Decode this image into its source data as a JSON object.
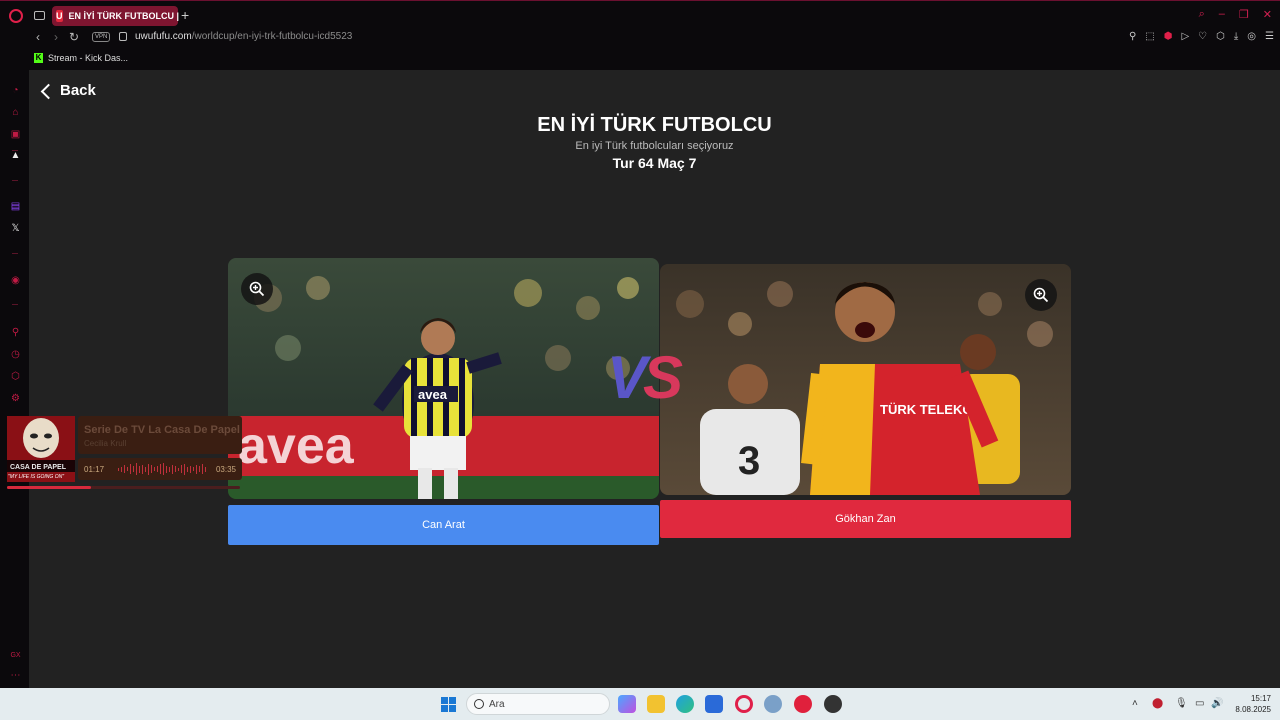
{
  "browser": {
    "tab_title": "EN İYİ TÜRK FUTBOLCU |",
    "tab_favicon_letter": "U",
    "vpn_badge": "VPN",
    "url_domain": "uwufufu.com",
    "url_path": "/worldcup/en-iyi-trk-futbolcu-icd5523",
    "bookmark": {
      "label": "Stream - Kick Das...",
      "icon": "kick-icon",
      "icon_letter": "K"
    }
  },
  "sidebar_bottom_label": "GX",
  "page": {
    "back_label": "Back",
    "title": "EN İYİ TÜRK FUTBOLCU",
    "subtitle": "En iyi Türk futbolcuları seçiyoruz",
    "round": "Tur 64 Maç 7",
    "vs": {
      "v": "V",
      "s": "S",
      "v_color": "#5a56c8",
      "s_color": "#d8385c"
    },
    "left_choice": {
      "name": "Can Arat",
      "button_color": "#4a8bf0",
      "photo_text": "avea"
    },
    "right_choice": {
      "name": "Gökhan Zan",
      "button_color": "#e0293e",
      "photo_text": "TÜRK TELEKOM",
      "opponent_number": "3"
    }
  },
  "mini_player": {
    "title": "Serie De TV La Casa De Papel",
    "artist": "Cecilia Krull",
    "elapsed": "01:17",
    "total": "03:35",
    "progress": 0.36,
    "art_caption": "\"MY LIFE IS GOING ON\"",
    "art_text": "CASA DE PAPEL"
  },
  "taskbar": {
    "search_placeholder": "Ara",
    "time": "15:17",
    "date": "8.08.2025"
  },
  "colors": {
    "accent": "#e0204a",
    "page_bg": "#222222",
    "taskbar_bg": "#e4ecef"
  }
}
